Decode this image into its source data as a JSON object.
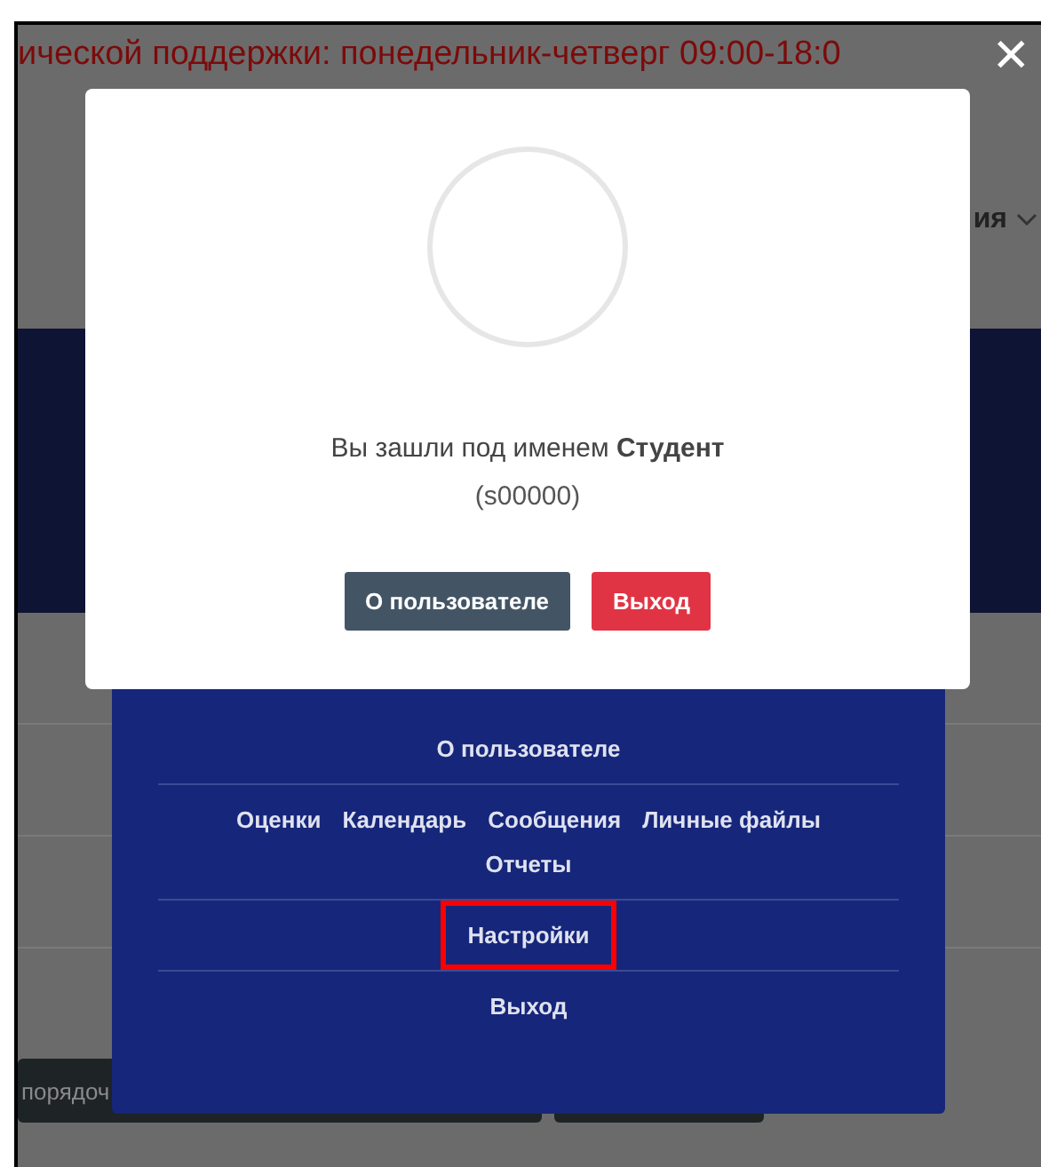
{
  "page": {
    "banner": "ической поддержки: понедельник-четверг 09:00-18:0",
    "nav_fragment": "ия",
    "bottom_button": "порядоч"
  },
  "close_button": "✕",
  "login_dialog": {
    "message": "Вы зашли под именем **Студент**",
    "user_id": "(s00000)",
    "buttons": [
      {
        "label": "О пользователе",
        "kind": "secondary"
      },
      {
        "label": "Выход",
        "kind": "danger"
      }
    ]
  },
  "user_menu": {
    "sections": [
      {
        "items": [
          {
            "label": "О пользователе",
            "highlighted": false
          }
        ]
      },
      {
        "items": [
          {
            "label": "Оценки",
            "highlighted": false
          },
          {
            "label": "Календарь",
            "highlighted": false
          },
          {
            "label": "Сообщения",
            "highlighted": false
          },
          {
            "label": "Личные файлы",
            "highlighted": false
          },
          {
            "label": "Отчеты",
            "highlighted": false
          }
        ]
      },
      {
        "items": [
          {
            "label": "Настройки",
            "highlighted": true
          }
        ]
      },
      {
        "items": [
          {
            "label": "Выход",
            "highlighted": false
          }
        ]
      }
    ]
  }
}
